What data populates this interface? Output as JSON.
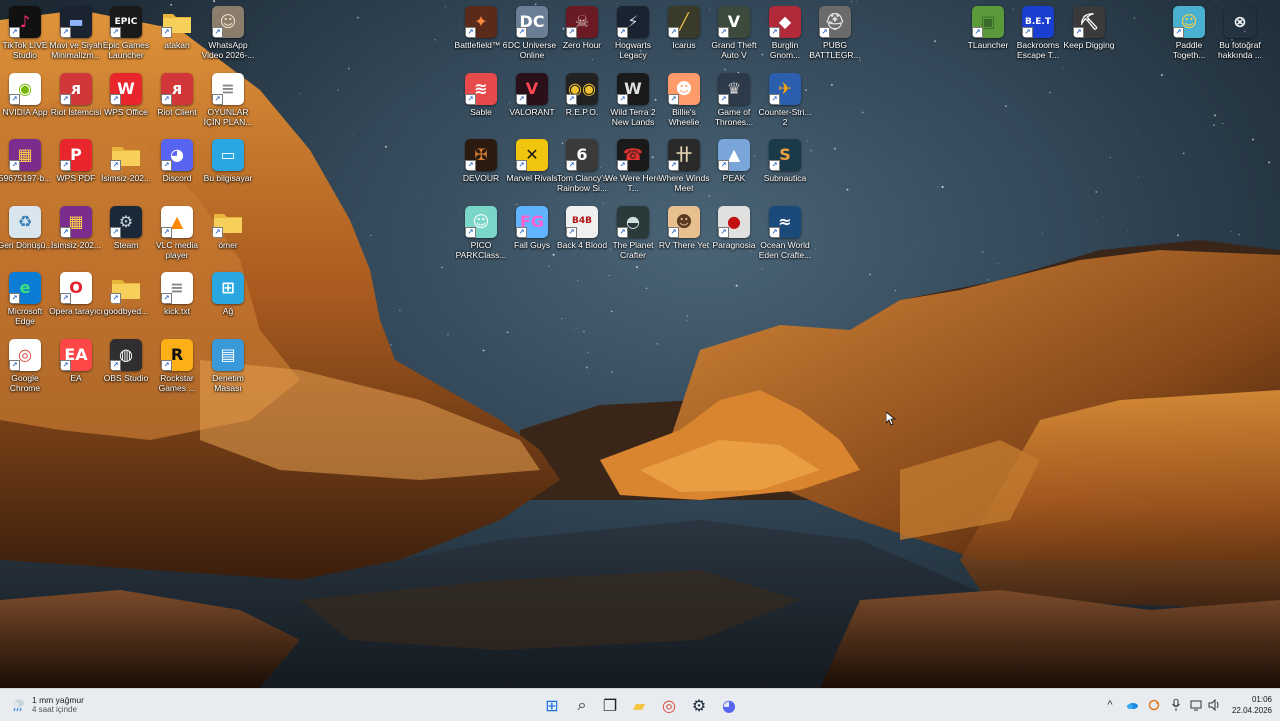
{
  "desktop": {
    "left_icons": [
      {
        "label": "TikTok LIVE Studio",
        "icon": "tiktok-icon",
        "bg": "#111111",
        "glyph": "♪",
        "color": "#ff2d6f"
      },
      {
        "label": "Mavi ve Siyah Minimalizm...",
        "icon": "presentation-icon",
        "bg": "#1b2230",
        "glyph": "▬",
        "color": "#8fb5ff"
      },
      {
        "label": "Epic Games Launcher",
        "icon": "epic-games-icon",
        "bg": "#1a1a1a",
        "glyph": "EPIC",
        "color": "#ffffff"
      },
      {
        "label": "atakan",
        "icon": "folder-icon",
        "bg": "#f4c542",
        "glyph": "",
        "color": "#ffffff"
      },
      {
        "label": "WhatsApp Video 2026-...",
        "icon": "video-thumbnail-icon",
        "bg": "#8b7d6b",
        "glyph": "☺",
        "color": "#f0e0c8"
      },
      {
        "label": "NVIDIA App",
        "icon": "nvidia-icon",
        "bg": "#ffffff",
        "glyph": "◉",
        "color": "#76b900"
      },
      {
        "label": "Riot İstemcisi",
        "icon": "riot-icon",
        "bg": "#d13639",
        "glyph": "ᴙ",
        "color": "#ffffff"
      },
      {
        "label": "WPS Office",
        "icon": "wps-office-icon",
        "bg": "#e8262c",
        "glyph": "W",
        "color": "#ffffff"
      },
      {
        "label": "Riot Client",
        "icon": "riot-client-icon",
        "bg": "#d13639",
        "glyph": "ᴙ",
        "color": "#ffffff"
      },
      {
        "label": "OYUNLAR İÇİN PLAN...",
        "icon": "text-file-icon",
        "bg": "#ffffff",
        "glyph": "≡",
        "color": "#888888"
      },
      {
        "label": "59675197-b...",
        "icon": "winrar-icon",
        "bg": "#7a2d8c",
        "glyph": "▦",
        "color": "#ffd24a"
      },
      {
        "label": "WPS PDF",
        "icon": "wps-pdf-icon",
        "bg": "#e8262c",
        "glyph": "P",
        "color": "#ffffff"
      },
      {
        "label": "İsimsiz-202...",
        "icon": "folder-icon",
        "bg": "#f4c542",
        "glyph": "",
        "color": "#ffffff"
      },
      {
        "label": "Discord",
        "icon": "discord-icon",
        "bg": "#5865f2",
        "glyph": "◕",
        "color": "#ffffff"
      },
      {
        "label": "Bu bilgisayar",
        "icon": "computer-icon",
        "bg": "#2aa7e0",
        "glyph": "▭",
        "color": "#ffffff"
      },
      {
        "label": "Geri Dönüşü...",
        "icon": "recycle-bin-icon",
        "bg": "#d9e6ee",
        "glyph": "♻",
        "color": "#3a7fb5"
      },
      {
        "label": "İsimsiz-202...",
        "icon": "winrar-icon",
        "bg": "#7a2d8c",
        "glyph": "▦",
        "color": "#ffd24a"
      },
      {
        "label": "Steam",
        "icon": "steam-icon",
        "bg": "#1b2838",
        "glyph": "⚙",
        "color": "#c7d5e0"
      },
      {
        "label": "VLC media player",
        "icon": "vlc-icon",
        "bg": "#ffffff",
        "glyph": "▲",
        "color": "#ff8800"
      },
      {
        "label": "ömer",
        "icon": "folder-icon",
        "bg": "#f4c542",
        "glyph": "",
        "color": "#ffffff"
      },
      {
        "label": "Microsoft Edge",
        "icon": "edge-icon",
        "bg": "#0c7cd5",
        "glyph": "e",
        "color": "#3ee07a"
      },
      {
        "label": "Opera tarayıcı",
        "icon": "opera-icon",
        "bg": "#ffffff",
        "glyph": "O",
        "color": "#e0232c"
      },
      {
        "label": "goodbyed...",
        "icon": "folder-icon",
        "bg": "#f4c542",
        "glyph": "",
        "color": "#ffffff"
      },
      {
        "label": "kick.txt",
        "icon": "text-file-icon",
        "bg": "#ffffff",
        "glyph": "≡",
        "color": "#888888"
      },
      {
        "label": "Ağ",
        "icon": "network-icon",
        "bg": "#2aa7e0",
        "glyph": "⊞",
        "color": "#ffffff"
      },
      {
        "label": "Google Chrome",
        "icon": "chrome-icon",
        "bg": "#ffffff",
        "glyph": "◎",
        "color": "#db4437"
      },
      {
        "label": "EA",
        "icon": "ea-icon",
        "bg": "#ff4747",
        "glyph": "EA",
        "color": "#ffffff"
      },
      {
        "label": "OBS Studio",
        "icon": "obs-icon",
        "bg": "#302e31",
        "glyph": "◍",
        "color": "#ffffff"
      },
      {
        "label": "Rockstar Games ...",
        "icon": "rockstar-icon",
        "bg": "#fcaf17",
        "glyph": "R",
        "color": "#111111"
      },
      {
        "label": "Denetim Masası",
        "icon": "control-panel-icon",
        "bg": "#3a9ad9",
        "glyph": "▤",
        "color": "#ffffff"
      }
    ],
    "center_icons": [
      {
        "label": "Battlefield™ 6",
        "icon": "battlefield-icon",
        "bg": "#5a2a1a",
        "glyph": "✦",
        "color": "#ff8a3d"
      },
      {
        "label": "DC Universe Online",
        "icon": "dc-universe-icon",
        "bg": "#6a7f95",
        "glyph": "DC",
        "color": "#ffffff"
      },
      {
        "label": "Zero Hour",
        "icon": "zero-hour-icon",
        "bg": "#6a1a22",
        "glyph": "☠",
        "color": "#d8c0c0"
      },
      {
        "label": "Hogwarts Legacy",
        "icon": "hogwarts-icon",
        "bg": "#1a2330",
        "glyph": "⚡",
        "color": "#c9d6e6"
      },
      {
        "label": "Icarus",
        "icon": "icarus-icon",
        "bg": "#3a3a2a",
        "glyph": "╱",
        "color": "#e6c24a"
      },
      {
        "label": "Grand Theft Auto V",
        "icon": "gta-icon",
        "bg": "#3b4a3a",
        "glyph": "V",
        "color": "#ffffff"
      },
      {
        "label": "Burglin Gnom...",
        "icon": "burglin-gnomes-icon",
        "bg": "#b02a3a",
        "glyph": "◆",
        "color": "#ffffff"
      },
      {
        "label": "PUBG BATTLEGR...",
        "icon": "pubg-icon",
        "bg": "#6b6b6b",
        "glyph": "⛑",
        "color": "#e0e0e0"
      },
      {
        "label": "Sable",
        "icon": "sable-icon",
        "bg": "#e64a4a",
        "glyph": "≋",
        "color": "#ffffff"
      },
      {
        "label": "VALORANT",
        "icon": "valorant-icon",
        "bg": "#2a1018",
        "glyph": "V",
        "color": "#ff4655"
      },
      {
        "label": "R.E.P.O.",
        "icon": "repo-icon",
        "bg": "#222222",
        "glyph": "◉◉",
        "color": "#f0c030"
      },
      {
        "label": "Wild Terra 2 New Lands",
        "icon": "wild-terra-icon",
        "bg": "#1a1a1a",
        "glyph": "W",
        "color": "#e0e0e0"
      },
      {
        "label": "Billie's Wheelie",
        "icon": "billies-wheelie-icon",
        "bg": "#ff9b6a",
        "glyph": "☻",
        "color": "#ffffff"
      },
      {
        "label": "Game of Thrones...",
        "icon": "game-of-thrones-icon",
        "bg": "#2d3a4a",
        "glyph": "♛",
        "color": "#d0d0d0"
      },
      {
        "label": "Counter-Stri... 2",
        "icon": "counter-strike-icon",
        "bg": "#2b5fae",
        "glyph": "✈",
        "color": "#ffa500"
      },
      {
        "label": "DEVOUR",
        "icon": "devour-icon",
        "bg": "#2a1a10",
        "glyph": "✠",
        "color": "#d07a30"
      },
      {
        "label": "Marvel Rivals",
        "icon": "marvel-rivals-icon",
        "bg": "#f1c40f",
        "glyph": "✕",
        "color": "#1a1a1a"
      },
      {
        "label": "Tom Clancy's Rainbow Si...",
        "icon": "rainbow-six-icon",
        "bg": "#3a3a3a",
        "glyph": "6",
        "color": "#ffffff"
      },
      {
        "label": "We Were Here T...",
        "icon": "we-were-here-icon",
        "bg": "#1a1a1a",
        "glyph": "☎",
        "color": "#e03030"
      },
      {
        "label": "Where Winds Meet",
        "icon": "where-winds-meet-icon",
        "bg": "#2a2a2a",
        "glyph": "卄",
        "color": "#e0d0b0"
      },
      {
        "label": "PEAK",
        "icon": "peak-icon",
        "bg": "#7aa5d8",
        "glyph": "▲",
        "color": "#ffffff"
      },
      {
        "label": "Subnautica",
        "icon": "subnautica-icon",
        "bg": "#1a3a4a",
        "glyph": "S",
        "color": "#f0a040"
      },
      {
        "label": "PICO PARKClass...",
        "icon": "pico-park-icon",
        "bg": "#7ad7c8",
        "glyph": "☺",
        "color": "#ffffff"
      },
      {
        "label": "Fall Guys",
        "icon": "fall-guys-icon",
        "bg": "#5fb3ff",
        "glyph": "FG",
        "color": "#ff5fd1"
      },
      {
        "label": "Back 4 Blood",
        "icon": "back-4-blood-icon",
        "bg": "#f0f0f0",
        "glyph": "B4B",
        "color": "#b01010"
      },
      {
        "label": "The Planet Crafter",
        "icon": "planet-crafter-icon",
        "bg": "#2a3a3a",
        "glyph": "◓",
        "color": "#d0e0e0"
      },
      {
        "label": "RV There Yet",
        "icon": "rv-there-yet-icon",
        "bg": "#e8c090",
        "glyph": "☻",
        "color": "#5a3a20"
      },
      {
        "label": "Paragnosia",
        "icon": "paragnosia-icon",
        "bg": "#e0e0e0",
        "glyph": "●",
        "color": "#c01010"
      },
      {
        "label": "Ocean World Eden Crafte...",
        "icon": "ocean-world-icon",
        "bg": "#1a4a7a",
        "glyph": "≈",
        "color": "#ffffff"
      }
    ],
    "right_icons": [
      {
        "label": "TLauncher",
        "icon": "tlauncher-icon",
        "bg": "#5a9a3a",
        "glyph": "▣",
        "color": "#3a6a2a"
      },
      {
        "label": "Backrooms Escape T...",
        "icon": "backrooms-icon",
        "bg": "#1a3fd0",
        "glyph": "B.E.T",
        "color": "#ffffff"
      },
      {
        "label": "Keep Digging",
        "icon": "keep-digging-icon",
        "bg": "#3a3a3a",
        "glyph": "⛏",
        "color": "#ffffff"
      },
      {
        "label": "Paddle Togeth...",
        "icon": "paddle-together-icon",
        "bg": "#4ab0d0",
        "glyph": "☺",
        "color": "#ffd040"
      },
      {
        "label": "Bu fotoğraf hakkında ...",
        "icon": "photo-info-icon",
        "bg": "transparent",
        "glyph": "⊗",
        "color": "#ffffff"
      }
    ]
  },
  "taskbar": {
    "weather": {
      "line1": "1 mm yağmur",
      "line2": "4 saat içinde"
    },
    "apps": [
      {
        "name": "start-button",
        "glyph": "⊞",
        "color": "#1a73e8"
      },
      {
        "name": "search-button",
        "glyph": "⌕",
        "color": "#222222"
      },
      {
        "name": "task-view-button",
        "glyph": "❐",
        "color": "#222222"
      },
      {
        "name": "file-explorer-button",
        "glyph": "▰",
        "color": "#f4c542"
      },
      {
        "name": "chrome-button",
        "glyph": "◎",
        "color": "#db4437"
      },
      {
        "name": "steam-button",
        "glyph": "⚙",
        "color": "#1b2838"
      },
      {
        "name": "discord-button",
        "glyph": "◕",
        "color": "#5865f2"
      }
    ],
    "tray": {
      "chevron": "^",
      "time": "01:06",
      "date": "22.04.2026"
    }
  }
}
